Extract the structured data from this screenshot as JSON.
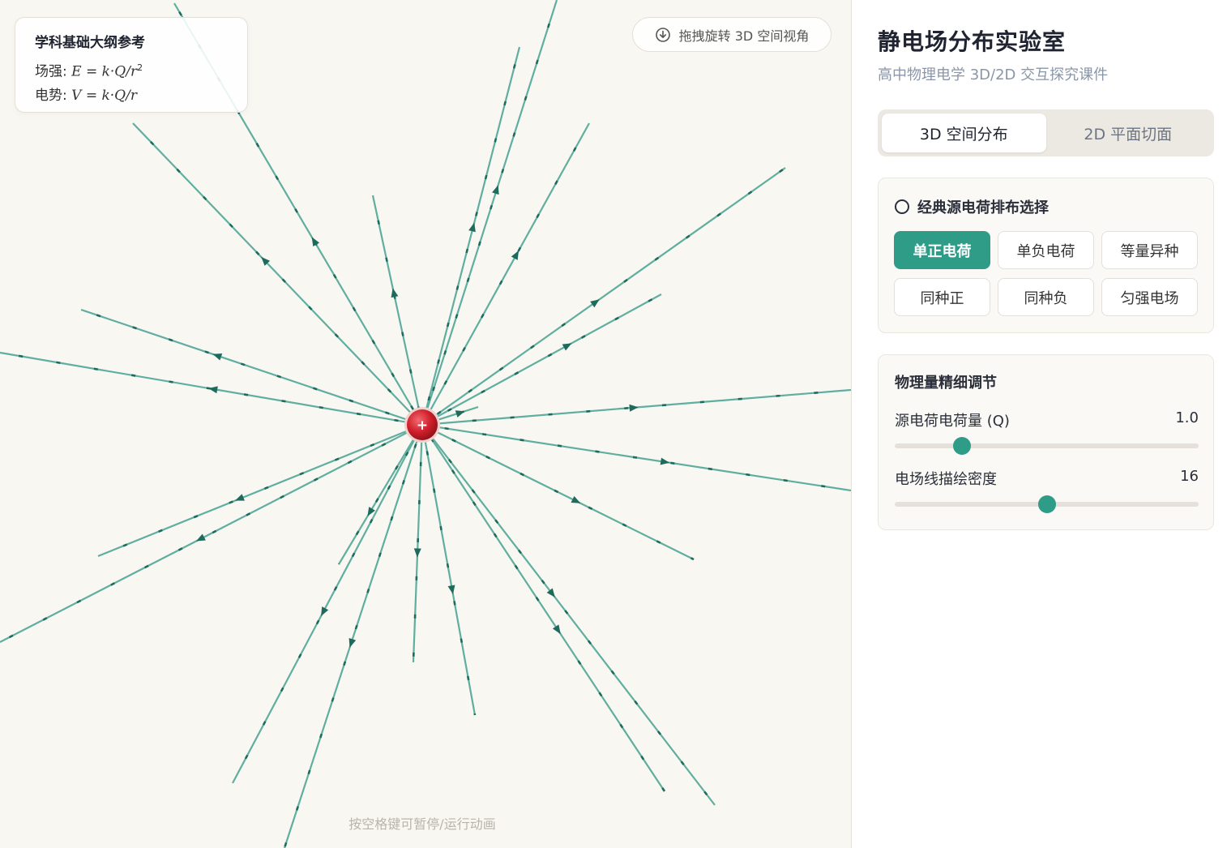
{
  "viewport": {
    "reference": {
      "title": "学科基础大纲参考",
      "field_label": "场强: ",
      "field_formula": "E = k·Q/r",
      "field_exp": "2",
      "potential_label": "电势: ",
      "potential_formula": "V = k·Q/r"
    },
    "rotate_hint": "拖拽旋转 3D 空间视角",
    "pause_hint": "按空格键可暂停/运行动画",
    "charge_symbol": "+",
    "colors": {
      "field_line": "#5fae9f",
      "arrow": "#1e6b5e",
      "charge": "#d0202c"
    }
  },
  "panel": {
    "title": "静电场分布实验室",
    "subtitle": "高中物理电学 3D/2D 交互探究课件",
    "modes": [
      {
        "label": "3D 空间分布",
        "active": true
      },
      {
        "label": "2D 平面切面",
        "active": false
      }
    ],
    "presets": {
      "heading": "经典源电荷排布选择",
      "items": [
        {
          "label": "单正电荷",
          "active": true
        },
        {
          "label": "单负电荷",
          "active": false
        },
        {
          "label": "等量异种",
          "active": false
        },
        {
          "label": "同种正",
          "active": false
        },
        {
          "label": "同种负",
          "active": false
        },
        {
          "label": "匀强电场",
          "active": false
        }
      ]
    },
    "physics": {
      "heading": "物理量精细调节",
      "charge": {
        "label": "源电荷电荷量 (Q)",
        "value": "1.0",
        "fraction": 0.22
      },
      "density": {
        "label": "电场线描绘密度",
        "value": "16",
        "fraction": 0.5
      }
    },
    "accent": "#2f9c88"
  }
}
